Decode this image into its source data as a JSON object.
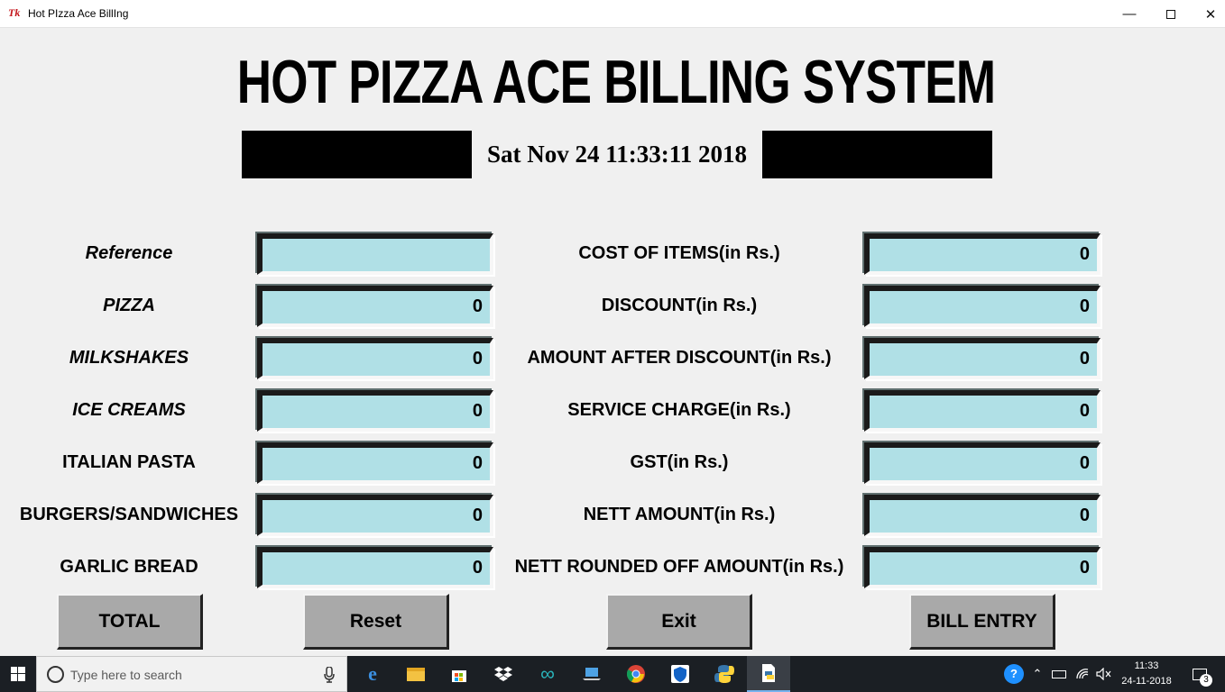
{
  "window": {
    "title": "Hot PIzza Ace BillIng",
    "icon_text": "Tk"
  },
  "header": {
    "title": "HOT PIZZA ACE BILLING SYSTEM",
    "datetime": "Sat Nov 24 11:33:11 2018"
  },
  "left_fields": [
    {
      "label": "Reference",
      "value": ""
    },
    {
      "label": "PIZZA",
      "value": "0"
    },
    {
      "label": "MILKSHAKES",
      "value": "0"
    },
    {
      "label": "ICE CREAMS",
      "value": "0"
    },
    {
      "label": "ITALIAN PASTA",
      "value": "0"
    },
    {
      "label": "BURGERS/SANDWICHES",
      "value": "0"
    },
    {
      "label": "GARLIC BREAD",
      "value": "0"
    }
  ],
  "right_fields": [
    {
      "label": "COST OF ITEMS(in Rs.)",
      "value": "0"
    },
    {
      "label": "DISCOUNT(in Rs.)",
      "value": "0"
    },
    {
      "label": "AMOUNT AFTER DISCOUNT(in Rs.)",
      "value": "0"
    },
    {
      "label": "SERVICE CHARGE(in Rs.)",
      "value": "0"
    },
    {
      "label": "GST(in Rs.)",
      "value": "0"
    },
    {
      "label": "NETT AMOUNT(in Rs.)",
      "value": "0"
    },
    {
      "label": "NETT ROUNDED OFF AMOUNT(in Rs.)",
      "value": "0"
    }
  ],
  "buttons": {
    "total": "TOTAL",
    "reset": "Reset",
    "exit": "Exit",
    "bill_entry": "BILL ENTRY"
  },
  "taskbar": {
    "search_placeholder": "Type here to search",
    "time": "11:33",
    "date": "24-11-2018",
    "notification_count": "3",
    "pinned_icons": [
      "edge-icon",
      "file-explorer-icon",
      "store-icon",
      "dropbox-icon",
      "arduino-icon",
      "laptop-icon",
      "chrome-icon",
      "security-icon",
      "python-icon",
      "python-file-icon"
    ]
  },
  "colors": {
    "entry_bg": "#b0e0e6",
    "button_bg": "#a9a9a9",
    "window_bg": "#f0f0f0",
    "taskbar_bg": "#1b1f24"
  }
}
